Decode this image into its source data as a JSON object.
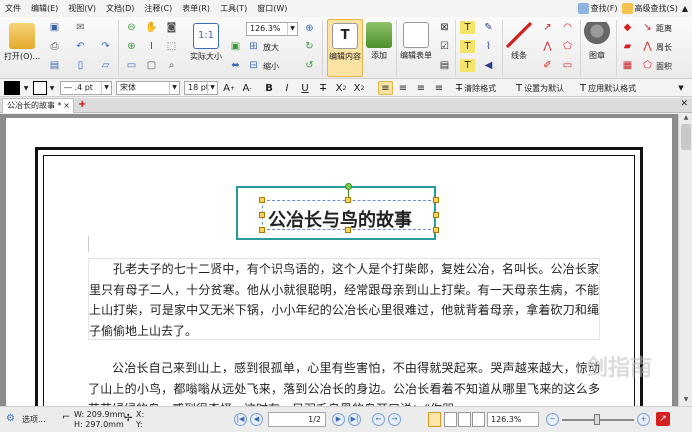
{
  "menu": {
    "items": [
      "文件",
      "编辑(E)",
      "视图(V)",
      "文档(D)",
      "注释(C)",
      "表单(R)",
      "工具(T)",
      "窗口(W)"
    ],
    "find_label": "查找(F)",
    "advanced_find_label": "高级查找(S)"
  },
  "ribbon": {
    "open_label": "打开(O)...",
    "zoom_value": "126.3%",
    "actual_size_label": "实际大小",
    "zoom_in_label": "放大",
    "zoom_out_label": "缩小",
    "edit_content_label": "编辑内容",
    "add_label": "添加",
    "edit_form_label": "编辑表单",
    "line_label": "线条",
    "stamp_label": "图章",
    "distance_label": "距离",
    "perimeter_label": "周长",
    "area_label": "面积"
  },
  "format_bar": {
    "line_width": ".4 pt",
    "font_name": "宋体",
    "font_size": "18 pt",
    "clear_format_label": "清除格式",
    "set_default_label": "设置为默认",
    "apply_default_label": "应用默认格式"
  },
  "tab": {
    "title": "公冶长的故事 *"
  },
  "document": {
    "title": "公冶长与鸟的故事",
    "paragraph1": "孔老夫子的七十二贤中，有个识鸟语的，这个人是个打柴郎，复姓公冶，名叫长。公冶长家里只有母子二人，十分贫寒。他从小就很聪明，经常跟母亲到山上打柴。有一天母亲生病，不能上山打柴，可是家中又无米下锅，小小年纪的公冶长心里很难过，他就背着母亲，拿着砍刀和绳子偷偷地上山去了。",
    "paragraph2": "公冶长自己来到山上，感到很孤单，心里有些害怕，不由得就哭起来。哭声越来越大，惊动了山上的小鸟，都嗡嗡从远处飞来，落到公冶长的身边。公冶长看着不知道从哪里飞来的这么多花花绿绿的鸟，感到很奇怪，这时有一只羽毛乌黑的鸟开口说：“你哭",
    "watermark": "剑指南"
  },
  "status": {
    "select_label": "选项...",
    "width_text": "W: 209.9mm",
    "height_text": "H: 297.0mm",
    "x_label": "X:",
    "y_label": "Y:",
    "page_text": "1/2",
    "zoom_value": "126.3%"
  },
  "colors": {
    "title_box_border": "#2a9a9a",
    "selection_handle": "#fbd25c",
    "highlight_button": "#fbe3a3"
  }
}
